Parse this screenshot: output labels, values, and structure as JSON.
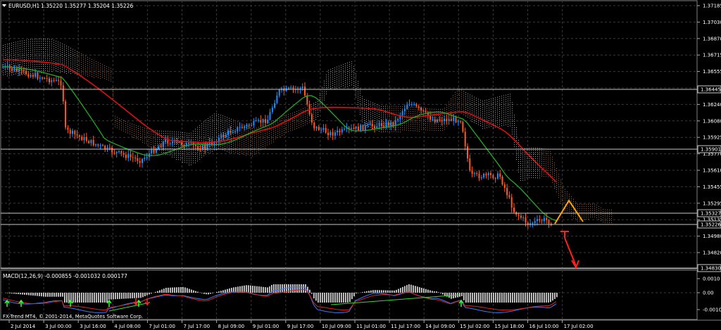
{
  "header": {
    "symbol_label": "EURUSD,H1",
    "ohlc": "1.35220 1.35277 1.35204 1.35226"
  },
  "macd": {
    "label": "MACD(12,26,9) -0.000855 -0.001032 0.000177"
  },
  "footer": {
    "branding": "FX-Trend MT4, © 2001-2014, MetaQuotes Software Corp."
  },
  "colors": {
    "background": "#000000",
    "bull_candle": "#1e90ff",
    "bear_candle": "#ff5a1f",
    "ma_fast": "#22aa22",
    "ma_slow": "#dd1111",
    "cloud_a": "#d8d8d8",
    "cloud_b": "#cc8855",
    "projection": "#ffa500",
    "arrow_down": "#ff2020",
    "arrow_up": "#33ff33"
  },
  "chart_data": {
    "type": "candlestick",
    "price_ticks": [
      "1.37185",
      "1.37030",
      "1.36870",
      "1.36715",
      "1.36555",
      "1.36395",
      "1.36240",
      "1.36080",
      "1.35925",
      "1.35770",
      "1.35610",
      "1.35455",
      "1.35295",
      "1.35135",
      "1.34980",
      "1.34820"
    ],
    "price_markers": [
      "1.36445",
      "1.35901",
      "1.35327",
      "1.35226",
      "1.34830"
    ],
    "time_ticks": [
      "2 Jul 2014",
      "3 Jul 00:00",
      "3 Jul 16:00",
      "4 Jul 08:00",
      "7 Jul 01:00",
      "7 Jul 17:00",
      "8 Jul 09:00",
      "9 Jul 01:00",
      "9 Jul 17:00",
      "10 Jul 09:00",
      "11 Jul 01:00",
      "11 Jul 17:00",
      "14 Jul 09:00",
      "15 Jul 02:00",
      "15 Jul 18:00",
      "16 Jul 10:00",
      "17 Jul 02:00"
    ],
    "macd_ticks": [
      "0.0010",
      "0.00",
      "-0.0010"
    ],
    "price_range": [
      1.3478,
      1.3724
    ],
    "grid": true
  }
}
